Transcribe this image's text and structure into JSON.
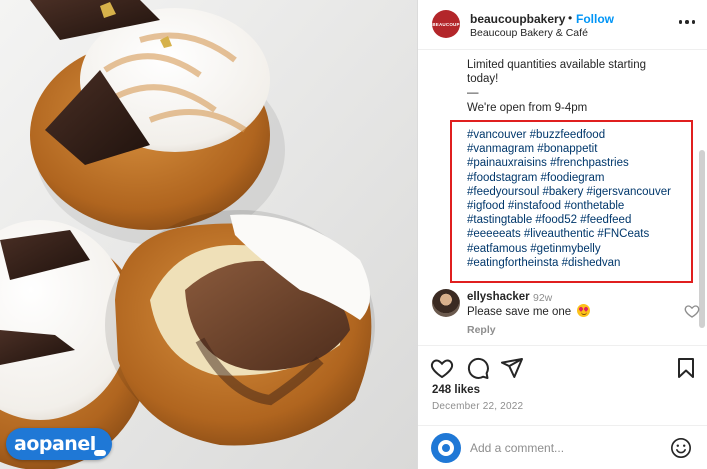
{
  "post": {
    "username": "beaucoupbakery",
    "separator": "•",
    "follow_label": "Follow",
    "subtitle": "Beaucoup Bakery & Café",
    "avatar_text": "BEAUCOUP",
    "caption_lines": [
      "Limited quantities available starting",
      "today!"
    ],
    "caption_divider": "—",
    "caption_hours": "We're open from 9-4pm",
    "hashtag_lines": [
      "#vancouver #buzzfeedfood",
      "#vanmagram #bonappetit",
      "#painauxraisins #frenchpastries",
      "#foodstagram #foodiegram",
      "#feedyoursoul #bakery #igersvancouver",
      "#igfood #instafood #onthetable",
      "#tastingtable #food52 #feedfeed",
      "#eeeeeats #liveauthentic #FNCeats",
      "#eatfamous #getinmybelly",
      "#eatingfortheinsta #dishedvan"
    ]
  },
  "comment": {
    "username": "ellyshacker",
    "time": "92w",
    "text": "Please save me one",
    "emoji": "heart-eyes-emoji",
    "reply_label": "Reply"
  },
  "actions": {
    "likes": "248 likes",
    "date": "December 22, 2022"
  },
  "add_comment": {
    "placeholder": "Add a comment..."
  },
  "watermark": {
    "text": "aopanel"
  },
  "colors": {
    "accent": "#0095f6",
    "hashtag": "#00376b",
    "highlight_border": "#e01f1f",
    "brand_avatar": "#b3262a",
    "watermark": "#1f78d6"
  }
}
